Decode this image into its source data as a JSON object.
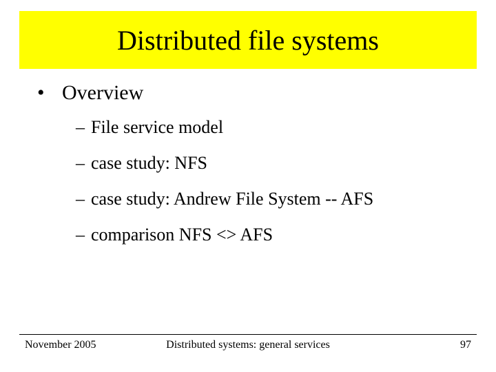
{
  "title": "Distributed file systems",
  "bullets": {
    "level1": {
      "marker": "•",
      "text": "Overview"
    },
    "level2": [
      {
        "dash": "–",
        "text": "File service model"
      },
      {
        "dash": "–",
        "text": "case study: NFS"
      },
      {
        "dash": "–",
        "text": "case study: Andrew File System --  AFS"
      },
      {
        "dash": "–",
        "text": "comparison NFS <> AFS"
      }
    ]
  },
  "footer": {
    "date": "November 2005",
    "center": "Distributed systems: general services",
    "page": "97"
  }
}
